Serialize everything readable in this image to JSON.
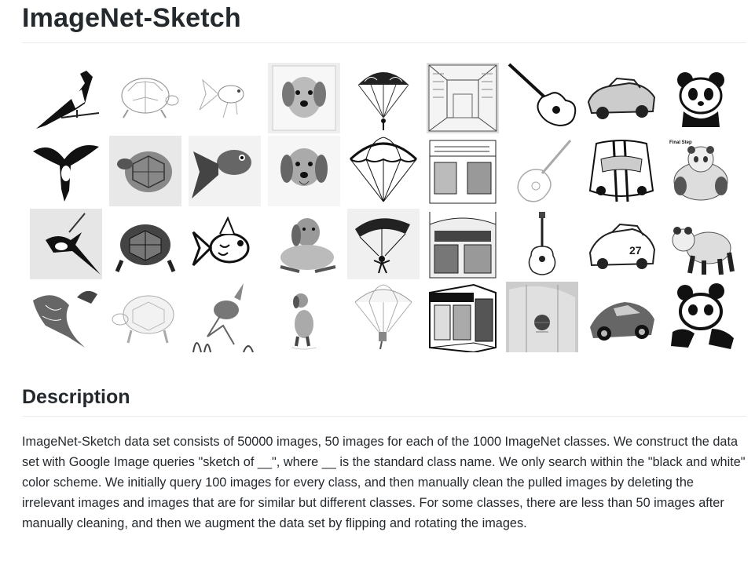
{
  "page": {
    "title": "ImageNet-Sketch",
    "description_heading": "Description",
    "description_text": "ImageNet-Sketch data set consists of 50000 images, 50 images for each of the 1000 ImageNet classes. We construct the data set with Google Image queries \"sketch of __\", where __ is the standard class name. We only search within the \"black and white\" color scheme. We initially query 100 images for every class, and then manually clean the pulled images by deleting the irrelevant images and images that are for similar but different classes. For some classes, there are less than 50 images after manually cleaning, and then we augment the data set by flipping and rotating the images."
  },
  "gallery": {
    "columns": [
      "magpie",
      "turtle",
      "goldfish",
      "golden-retriever",
      "parachute",
      "bookshop",
      "guitar",
      "sports-car",
      "panda"
    ],
    "rows": 4,
    "captions": {
      "panda_row2": "Final Step"
    }
  },
  "colors": {
    "heading": "#24292e",
    "text": "#24292e",
    "rule": "#eaecef",
    "background": "#ffffff"
  }
}
